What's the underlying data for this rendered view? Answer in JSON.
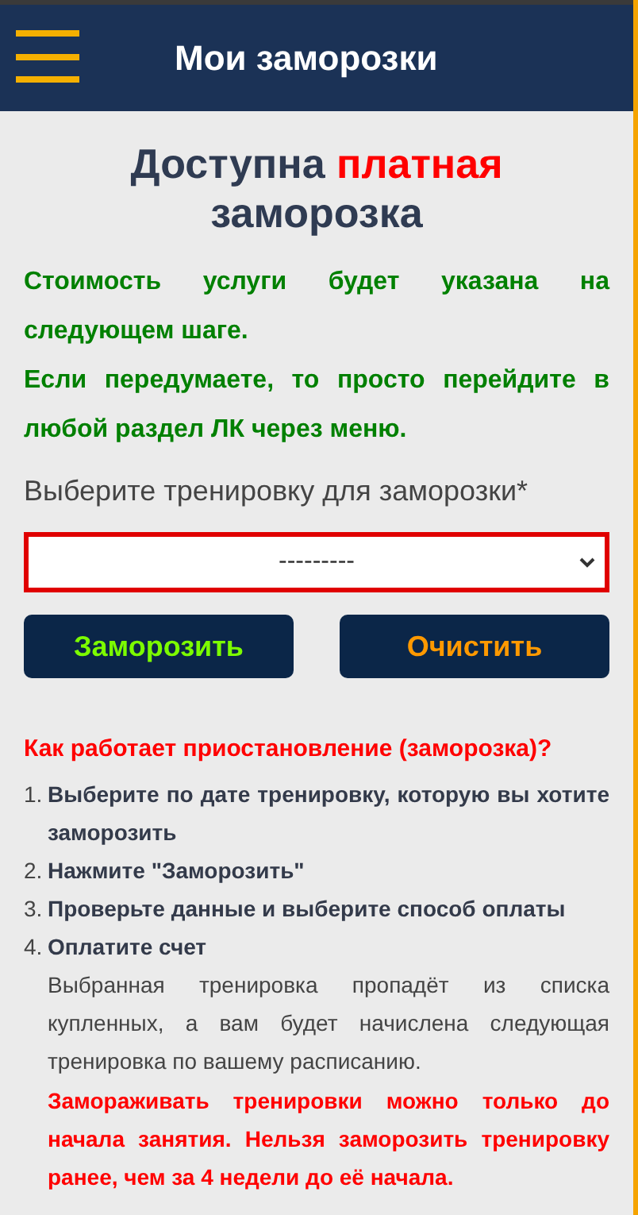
{
  "header": {
    "title": "Мои заморозки"
  },
  "heading": {
    "before": "Доступна",
    "accent": "платная",
    "after": "заморозка"
  },
  "notice": [
    "Стоимость услуги будет указана на следующем шаге.",
    "Если передумаете, то просто перейдите в любой раздел ЛК через меню."
  ],
  "form": {
    "label": "Выберите тренировку для заморозки",
    "required_mark": "*",
    "select_value": "---------"
  },
  "buttons": [
    {
      "label": "Заморозить",
      "kind": "freeze"
    },
    {
      "label": "Очистить",
      "kind": "clear"
    }
  ],
  "help": {
    "title": "Как работает приостановление (заморозка)?",
    "steps": [
      {
        "number": "1.",
        "text": "Выберите по дате тренировку, которую вы хотите заморозить"
      },
      {
        "number": "2.",
        "text": "Нажмите \"Заморозить\""
      },
      {
        "number": "3.",
        "text": "Проверьте данные и выберите способ оплаты"
      },
      {
        "number": "4.",
        "text": "Оплатите счет"
      }
    ],
    "note": "Выбранная тренировка пропадёт из списка купленных, а вам будет начислена следующая тренировка по вашему расписанию.",
    "warning": "Замораживать тренировки можно только до начала занятия. Нельзя заморозить тренировку ранее, чем за 4 недели до её начала."
  }
}
